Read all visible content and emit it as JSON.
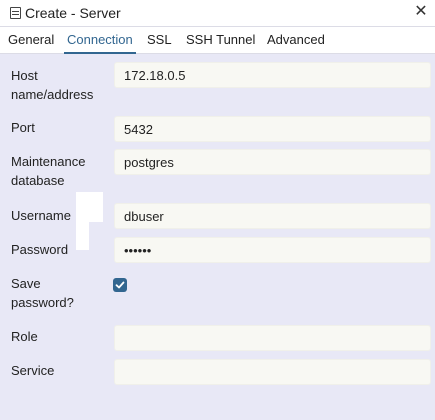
{
  "dialog": {
    "title": "Create - Server",
    "close_glyph": "✕"
  },
  "tabs": [
    {
      "label": "General"
    },
    {
      "label": "Connection"
    },
    {
      "label": "SSL"
    },
    {
      "label": "SSH Tunnel"
    },
    {
      "label": "Advanced"
    }
  ],
  "active_tab": "Connection",
  "form": {
    "host": {
      "label_line1": "Host",
      "label_line2": "name/address",
      "value": "172.18.0.5"
    },
    "port": {
      "label": "Port",
      "value": "5432"
    },
    "maintenance_db": {
      "label_line1": "Maintenance",
      "label_line2": "database",
      "value": "postgres"
    },
    "username": {
      "label": "Username",
      "value": "dbuser"
    },
    "password": {
      "label": "Password",
      "value": "••••••"
    },
    "save_password": {
      "label_line1": "Save",
      "label_line2": "password?",
      "checked": true
    },
    "role": {
      "label": "Role",
      "value": ""
    },
    "service": {
      "label": "Service",
      "value": ""
    }
  },
  "colors": {
    "accent": "#326690",
    "background": "#e8e8f6",
    "input_bg": "#f8f8f3"
  },
  "icons": {
    "title_icon": "server-dialog-icon",
    "close_icon": "close-icon",
    "checkbox_icon": "check-icon"
  }
}
